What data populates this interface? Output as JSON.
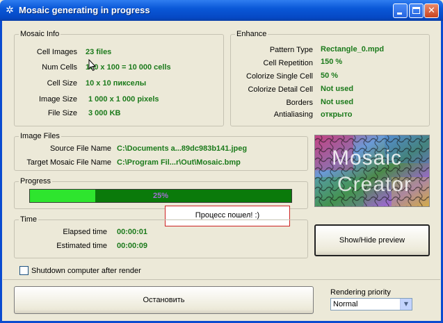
{
  "window": {
    "title": "Mosaic generating in progress",
    "icon": "mosaic-app-icon",
    "controls": {
      "minimize": "minimize-icon",
      "maximize": "maximize-icon",
      "close": "close-icon"
    }
  },
  "mosaic_info": {
    "title": "Mosaic Info",
    "rows": [
      {
        "label": "Cell Images",
        "value": "23 files"
      },
      {
        "label": "Num Cells",
        "value": "100 x 100 = 10 000 cells"
      },
      {
        "label": "Cell Size",
        "value": "10 x 10  пикселы"
      },
      {
        "label": "Image Size",
        "value": "1 000  x  1 000  pixels"
      },
      {
        "label": "File Size",
        "value": "3 000 KB"
      }
    ]
  },
  "enhance": {
    "title": "Enhance",
    "rows": [
      {
        "label": "Pattern Type",
        "value": "Rectangle_0.mpd"
      },
      {
        "label": "Cell Repetition",
        "value": "150 %"
      },
      {
        "label": "Colorize Single Cell",
        "value": "50 %"
      },
      {
        "label": "Colorize Detail Cell",
        "value": "Not used"
      },
      {
        "label": "Borders",
        "value": "Not used"
      },
      {
        "label": "Antialiasing",
        "value": "открыто"
      }
    ]
  },
  "image_files": {
    "title": "Image Files",
    "source_label": "Source File Name",
    "source_value": "C:\\Documents a...89dc983b141.jpeg",
    "target_label": "Target Mosaic File Name",
    "target_value": "C:\\Program Fil...r\\Out\\Mosaic.bmp"
  },
  "progress": {
    "title": "Progress",
    "percent_text": "25%",
    "fraction": 0.25,
    "popup": "Процесс пошел! :)"
  },
  "time": {
    "title": "Time",
    "elapsed_label": "Elapsed time",
    "elapsed_value": "00:00:01",
    "estimated_label": "Estimated time",
    "estimated_value": "00:00:09"
  },
  "preview": {
    "line1": "Mosaic",
    "line2": "Creator",
    "toggle_button": "Show/Hide preview"
  },
  "shutdown_checkbox": {
    "label": "Shutdown computer after render",
    "checked": false
  },
  "stop_button": "Остановить",
  "rendering_priority": {
    "label": "Rendering priority",
    "selected": "Normal"
  },
  "colors": {
    "value_green": "#1b7a1b",
    "progress_fill": "#2ee52e",
    "progress_track": "#0a7a0a",
    "titlebar": "#0548c4"
  }
}
